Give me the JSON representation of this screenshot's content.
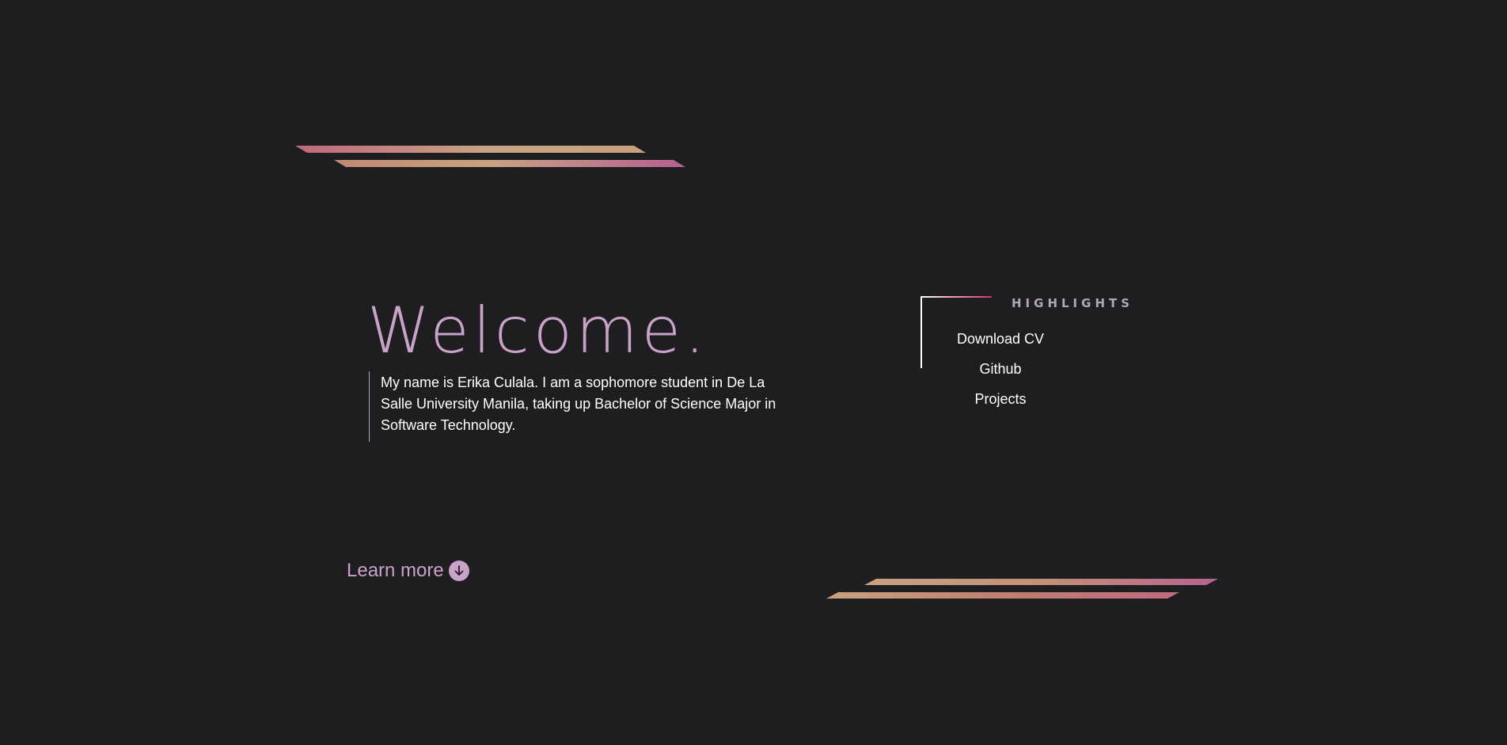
{
  "hero": {
    "title": "Welcome.",
    "intro": "My name is Erika Culala. I am a sophomore student in De La Salle University Manila, taking up Bachelor of Science Major in Software Technology."
  },
  "highlights": {
    "title": "HIGHLIGHTS",
    "items": [
      {
        "label": "Download CV"
      },
      {
        "label": "Github"
      },
      {
        "label": "Projects"
      }
    ]
  },
  "learn_more": {
    "label": "Learn more",
    "icon": "arrow-down-circle-icon"
  },
  "colors": {
    "background": "#1e1e20",
    "accent_lilac": "#c8a2c8",
    "text": "#ffffff",
    "stripe_pink": "#c0687e",
    "stripe_tan": "#c8a282",
    "stripe_magenta": "#b65f92",
    "frame_accent": "#d42e6a"
  }
}
